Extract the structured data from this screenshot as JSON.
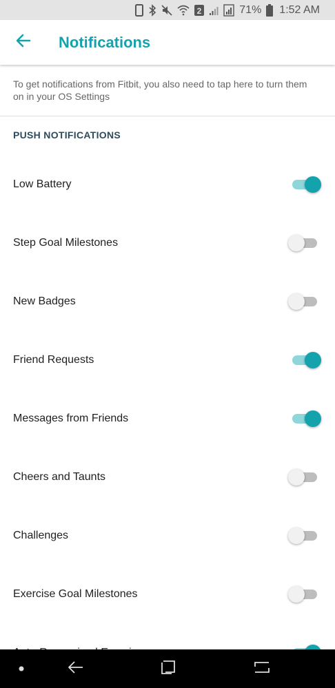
{
  "status_bar": {
    "battery_percent": "71%",
    "time": "1:52 AM",
    "notification_count": "2",
    "icons": [
      "phone-icon",
      "bluetooth-icon",
      "mute-icon",
      "wifi-icon",
      "sim-badge-icon",
      "signal-icon",
      "signal-alt-icon",
      "battery-icon"
    ]
  },
  "header": {
    "title": "Notifications",
    "back_icon": "arrow-left-icon"
  },
  "notice": {
    "text": "To get notifications from Fitbit, you also need to tap here to turn them on in your OS Settings"
  },
  "section": {
    "title": "PUSH NOTIFICATIONS"
  },
  "settings": [
    {
      "label": "Low Battery",
      "enabled": true
    },
    {
      "label": "Step Goal Milestones",
      "enabled": false
    },
    {
      "label": "New Badges",
      "enabled": false
    },
    {
      "label": "Friend Requests",
      "enabled": true
    },
    {
      "label": "Messages from Friends",
      "enabled": true
    },
    {
      "label": "Cheers and Taunts",
      "enabled": false
    },
    {
      "label": "Challenges",
      "enabled": false
    },
    {
      "label": "Exercise Goal Milestones",
      "enabled": false
    },
    {
      "label": "Auto-Recognized Exercises",
      "enabled": true
    }
  ],
  "colors": {
    "accent": "#14a3ad",
    "toggle_on_track": "#8fd6db",
    "toggle_off_track": "#bdbdbd",
    "section_header": "#2f4a59"
  },
  "nav_bar": {
    "icons": [
      "dot-icon",
      "back-nav-icon",
      "recents-icon",
      "home-icon"
    ]
  }
}
